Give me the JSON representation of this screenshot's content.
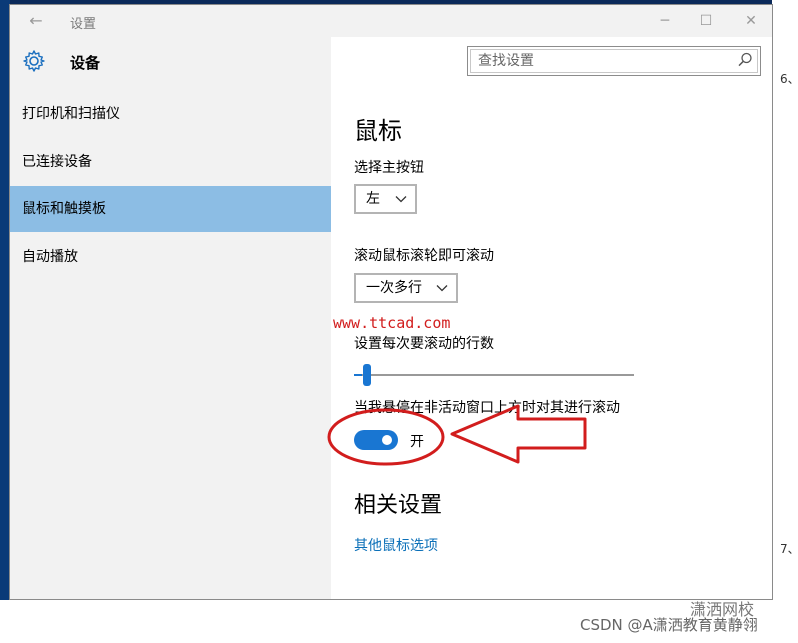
{
  "window": {
    "title": "设置",
    "controls": {
      "minimize": "─",
      "maximize": "☐",
      "close": "✕"
    }
  },
  "left_pane": {
    "header_title": "设备",
    "nav_items": [
      {
        "label": "打印机和扫描仪",
        "active": false
      },
      {
        "label": "已连接设备",
        "active": false
      },
      {
        "label": "鼠标和触摸板",
        "active": true
      },
      {
        "label": "自动播放",
        "active": false
      }
    ]
  },
  "search": {
    "placeholder": "查找设置",
    "value": ""
  },
  "mouse": {
    "title": "鼠标",
    "primary_button_label": "选择主按钮",
    "primary_button_value": "左",
    "scroll_label": "滚动鼠标滚轮即可滚动",
    "scroll_value": "一次多行",
    "lines_label": "设置每次要滚动的行数",
    "lines_slider_fraction": 0.03,
    "inactive_scroll_label": "当我悬停在非活动窗口上方时对其进行滚动",
    "toggle_state_label": "开",
    "toggle_on": true
  },
  "related": {
    "title": "相关设置",
    "link": "其他鼠标选项"
  },
  "watermarks": {
    "url": "www.ttcad.com",
    "footer": "CSDN @A潇洒教育黄静翎",
    "logo": "潇洒网校"
  },
  "desktop": {
    "right_text_1": "6、",
    "right_text_2": "7、"
  },
  "colors": {
    "accent": "#1976d2",
    "nav_active": "#8cbde4",
    "link": "#0a6fb8",
    "annotation_red": "#d21d1d"
  }
}
